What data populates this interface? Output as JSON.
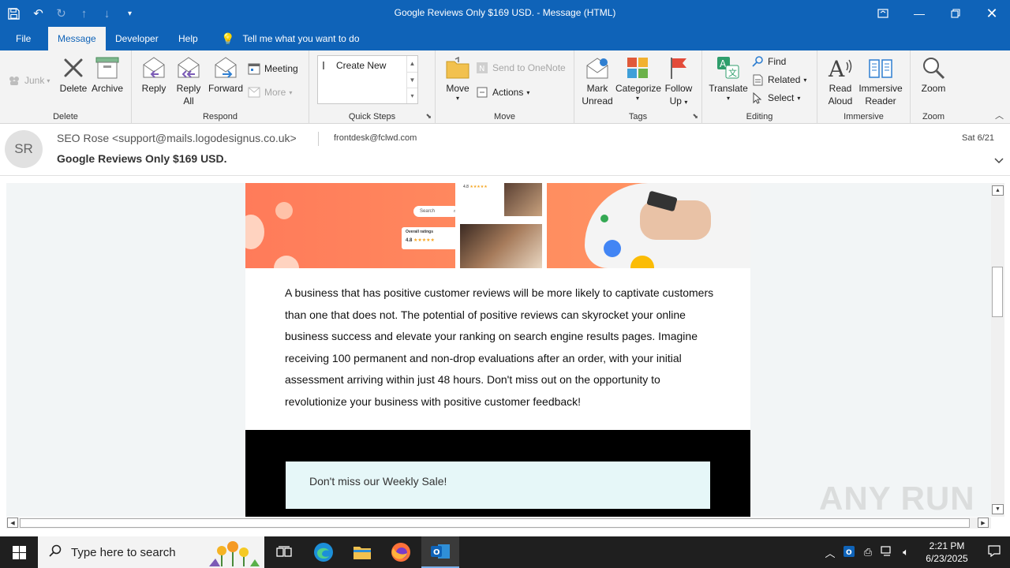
{
  "window": {
    "title": "Google Reviews Only $169 USD.  -  Message (HTML)"
  },
  "tabs": {
    "file": "File",
    "message": "Message",
    "developer": "Developer",
    "help": "Help",
    "tell_me": "Tell me what you want to do"
  },
  "ribbon": {
    "delete_group": {
      "label": "Delete",
      "junk": "Junk",
      "delete": "Delete",
      "archive": "Archive"
    },
    "respond_group": {
      "label": "Respond",
      "reply": "Reply",
      "reply_all_1": "Reply",
      "reply_all_2": "All",
      "forward": "Forward",
      "meeting": "Meeting",
      "more": "More"
    },
    "quicksteps_group": {
      "label": "Quick Steps",
      "create_new": "Create New"
    },
    "move_group": {
      "label": "Move",
      "move": "Move",
      "onenote": "Send to OneNote",
      "actions": "Actions"
    },
    "tags_group": {
      "label": "Tags",
      "mark_unread_1": "Mark",
      "mark_unread_2": "Unread",
      "categorize": "Categorize",
      "follow_up_1": "Follow",
      "follow_up_2": "Up"
    },
    "editing_group": {
      "label": "Editing",
      "translate": "Translate",
      "find": "Find",
      "related": "Related",
      "select": "Select"
    },
    "immersive_group": {
      "label": "Immersive",
      "read_aloud_1": "Read",
      "read_aloud_2": "Aloud",
      "immersive_reader_1": "Immersive",
      "immersive_reader_2": "Reader"
    },
    "zoom_group": {
      "label": "Zoom",
      "zoom": "Zoom"
    }
  },
  "message": {
    "avatar_initials": "SR",
    "sender": "SEO Rose <support@mails.logodesignus.co.uk>",
    "recipient": "frontdesk@fclwd.com",
    "date": "Sat 6/21",
    "subject": "Google Reviews Only $169 USD."
  },
  "email_body": {
    "banner": {
      "search": "Search",
      "overall_ratings": "Overall ratings",
      "rating_value": "4.8",
      "card_rating": "4.8"
    },
    "paragraph": "A business that has positive customer reviews will be more likely to captivate customers than one that does not. The potential of positive reviews can skyrocket your online business success and elevate your ranking on search engine results pages. Imagine receiving 100 permanent and non-drop evaluations after an order, with your initial assessment arriving within just 48 hours. Don't miss out on the opportunity to revolutionize your business with positive customer feedback!",
    "sale_text": "Don't miss our Weekly Sale!"
  },
  "watermark": "ANY RUN",
  "taskbar": {
    "search_placeholder": "Type here to search",
    "time": "2:21 PM",
    "date": "6/23/2025"
  },
  "colors": {
    "accent": "#0f63b8",
    "banner": "#ff8c5f",
    "sale_box": "#e6f7f8"
  }
}
